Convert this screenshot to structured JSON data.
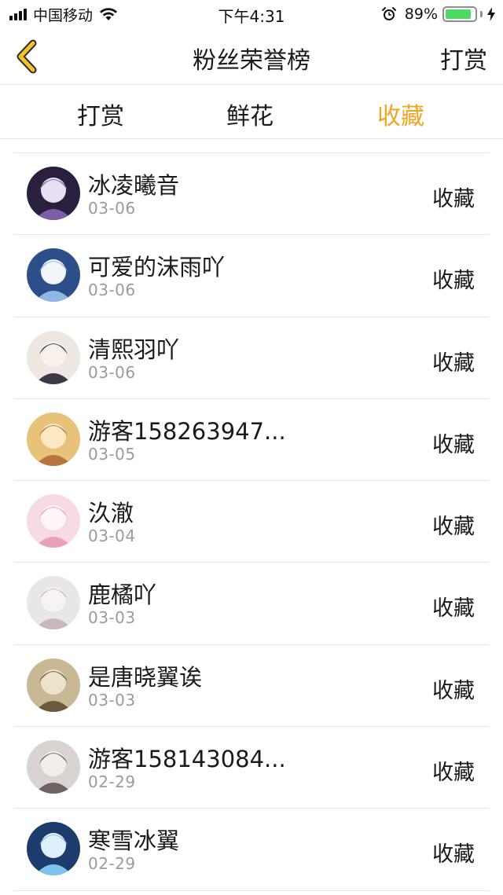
{
  "status_bar": {
    "carrier": "中国移动",
    "time": "下午4:31",
    "battery_percent": "89%",
    "battery_level": 0.89,
    "icons": [
      "signal-icon",
      "wifi-icon",
      "alarm-icon",
      "battery-icon",
      "charging-icon"
    ]
  },
  "nav": {
    "title": "粉丝荣誉榜",
    "right_label": "打赏",
    "back_icon": "chevron-left-icon",
    "accent_color": "#f2a51f"
  },
  "tabs": [
    {
      "label": "打赏",
      "active": false
    },
    {
      "label": "鲜花",
      "active": false
    },
    {
      "label": "收藏",
      "active": true
    }
  ],
  "fans": [
    {
      "name": "冰凌曦音",
      "date": "03-06",
      "action": "收藏"
    },
    {
      "name": "可爱的沫雨吖",
      "date": "03-06",
      "action": "收藏"
    },
    {
      "name": "清熙羽吖",
      "date": "03-06",
      "action": "收藏"
    },
    {
      "name": "游客158263947...",
      "date": "03-05",
      "action": "收藏"
    },
    {
      "name": "汣澈",
      "date": "03-04",
      "action": "收藏"
    },
    {
      "name": "鹿橘吖",
      "date": "03-03",
      "action": "收藏"
    },
    {
      "name": "是唐晓翼诶",
      "date": "03-03",
      "action": "收藏"
    },
    {
      "name": "游客158143084...",
      "date": "02-29",
      "action": "收藏"
    },
    {
      "name": "寒雪冰翼",
      "date": "02-29",
      "action": "收藏"
    }
  ]
}
